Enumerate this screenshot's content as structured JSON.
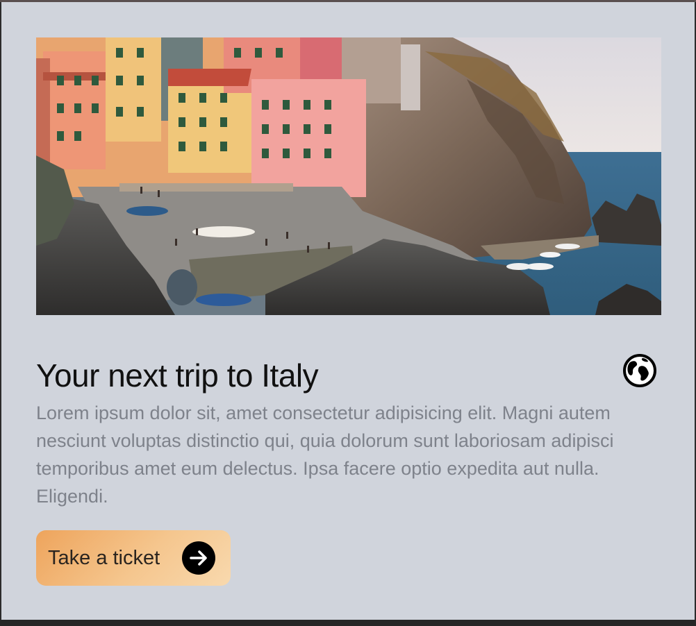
{
  "card": {
    "image_alt": "Colorful cliffside village by the sea",
    "title": "Your next trip to Italy",
    "description": "Lorem ipsum dolor sit, amet consectetur adipisicing elit. Magni autem nesciunt voluptas distinctio qui, quia dolorum sunt laboriosam adipisci temporibus amet eum delectus. Ipsa facere optio expedita aut nulla. Eligendi.",
    "header_icon": "globe-icon",
    "cta": {
      "label": "Take a ticket",
      "icon": "arrow-right-circle-icon"
    }
  },
  "colors": {
    "card_background": "#d0d4dc",
    "title_text": "#111111",
    "body_text": "#7e828b",
    "button_gradient_start": "#eea45c",
    "button_gradient_end": "#f8d9ae",
    "page_frame": "#262626"
  }
}
